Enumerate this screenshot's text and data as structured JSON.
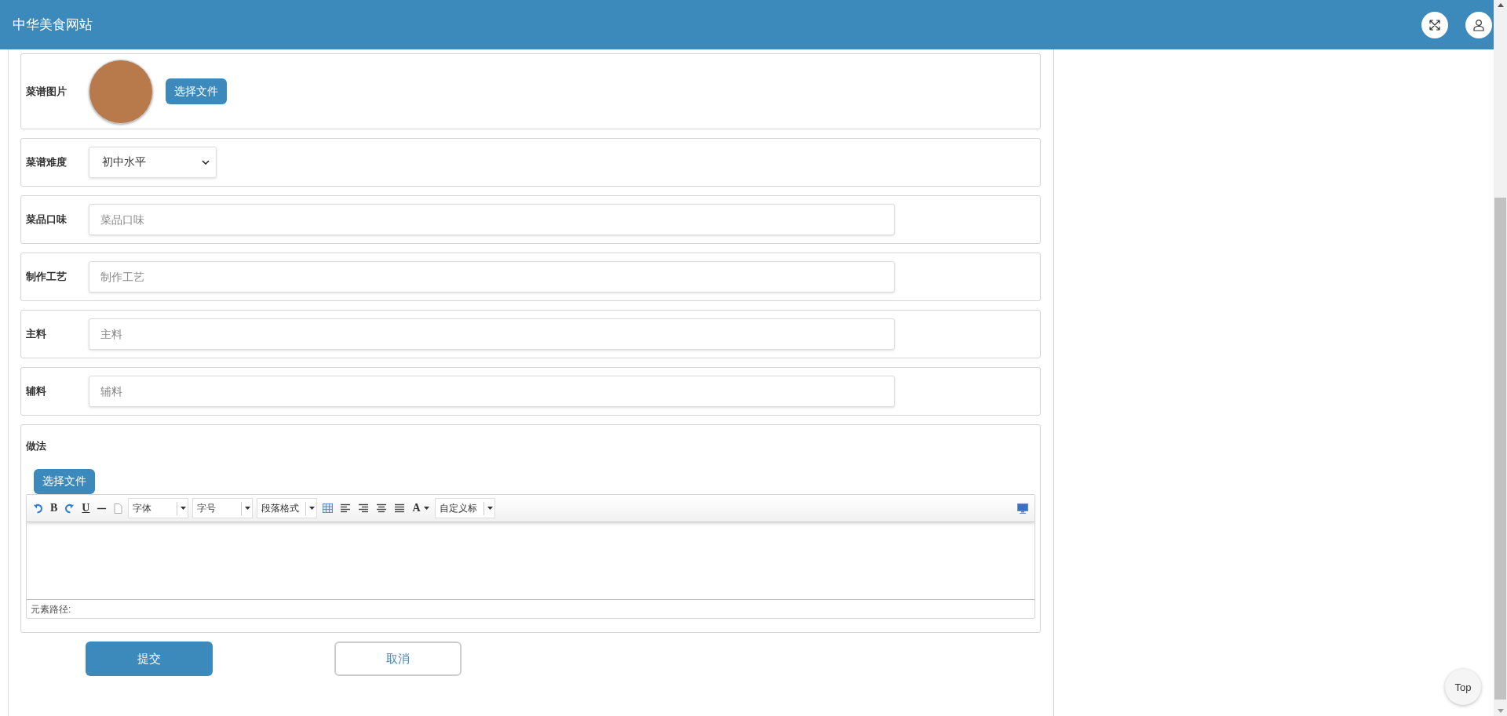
{
  "header": {
    "title": "中华美食网站"
  },
  "form": {
    "rows": [
      {
        "kind": "image",
        "label": "菜谱图片",
        "button": "选择文件"
      },
      {
        "kind": "select",
        "label": "菜谱难度",
        "value": "初中水平"
      },
      {
        "kind": "text",
        "label": "菜品口味",
        "placeholder": "菜品口味"
      },
      {
        "kind": "text",
        "label": "制作工艺",
        "placeholder": "制作工艺"
      },
      {
        "kind": "text",
        "label": "主料",
        "placeholder": "主料"
      },
      {
        "kind": "text",
        "label": "辅料",
        "placeholder": "辅料"
      }
    ],
    "method": {
      "label": "做法",
      "button": "选择文件",
      "toolbar": [
        {
          "kind": "undo"
        },
        {
          "kind": "glyph",
          "label": "B"
        },
        {
          "kind": "redo"
        },
        {
          "kind": "glyph",
          "label": "U"
        },
        {
          "kind": "rule"
        },
        {
          "kind": "page"
        },
        {
          "kind": "dropdown",
          "label": "字体"
        },
        {
          "kind": "dropdown",
          "label": "字号"
        },
        {
          "kind": "dropdown",
          "label": "段落格式"
        },
        {
          "kind": "table"
        },
        {
          "kind": "alignleft"
        },
        {
          "kind": "alignright"
        },
        {
          "kind": "aligncenter"
        },
        {
          "kind": "justify"
        },
        {
          "kind": "color",
          "label": "A"
        },
        {
          "kind": "dropdown",
          "label": "自定义标"
        }
      ],
      "status": "元素路径:"
    },
    "buttons": [
      {
        "kind": "primary",
        "label": "提交"
      },
      {
        "kind": "secondary",
        "label": "取消"
      }
    ]
  },
  "top_button": "Top"
}
